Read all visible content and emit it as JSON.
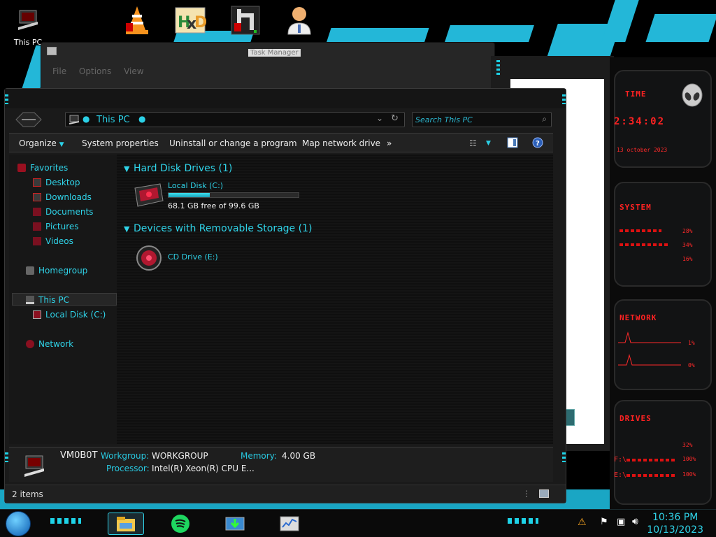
{
  "desktop": {
    "icons": [
      {
        "label": "This PC"
      }
    ]
  },
  "taskmanager": {
    "title": "Task Manager",
    "menu": [
      "File",
      "Options",
      "View"
    ]
  },
  "explorer": {
    "breadcrumb": "This PC",
    "search_placeholder": "Search This PC",
    "toolbar": {
      "organize": "Organize",
      "system_properties": "System properties",
      "uninstall": "Uninstall or change a program",
      "map_drive": "Map network drive",
      "more": "»"
    },
    "nav": {
      "favorites": "Favorites",
      "desktop": "Desktop",
      "downloads": "Downloads",
      "documents": "Documents",
      "pictures": "Pictures",
      "videos": "Videos",
      "homegroup": "Homegroup",
      "this_pc": "This PC",
      "local_disk": "Local Disk (C:)",
      "network": "Network"
    },
    "groups": {
      "hdd": "Hard Disk Drives (1)",
      "removable": "Devices with Removable Storage (1)"
    },
    "drives": {
      "c_name": "Local Disk (C:)",
      "c_free": "68.1 GB free of 99.6 GB",
      "c_used_fraction": 0.316,
      "e_name": "CD Drive (E:)"
    },
    "details": {
      "computer": "VM0B0T",
      "workgroup_label": "Workgroup:",
      "workgroup": "WORKGROUP",
      "memory_label": "Memory:",
      "memory": "4.00 GB",
      "processor_label": "Processor:",
      "processor": "Intel(R) Xeon(R) CPU E..."
    },
    "item_count": "2 items"
  },
  "gadget": {
    "time_title": "TIME",
    "time": "2:34:02",
    "date": "13 october 2023",
    "system_title": "SYSTEM",
    "cpu": "28%",
    "ram": "34%",
    "disk": "16%",
    "network_title": "NETWORK",
    "net_up": "1%",
    "net_down": "0%",
    "drives_title": "DRIVES",
    "d1": "32%",
    "f_label": "F:\\",
    "f_val": "100%",
    "e_label": "E:\\",
    "e_val": "100%"
  },
  "taskbar": {
    "time": "10:36 PM",
    "date": "10/13/2023"
  },
  "colors": {
    "accent": "#2fd3e8",
    "alert": "#ff2a2a"
  }
}
